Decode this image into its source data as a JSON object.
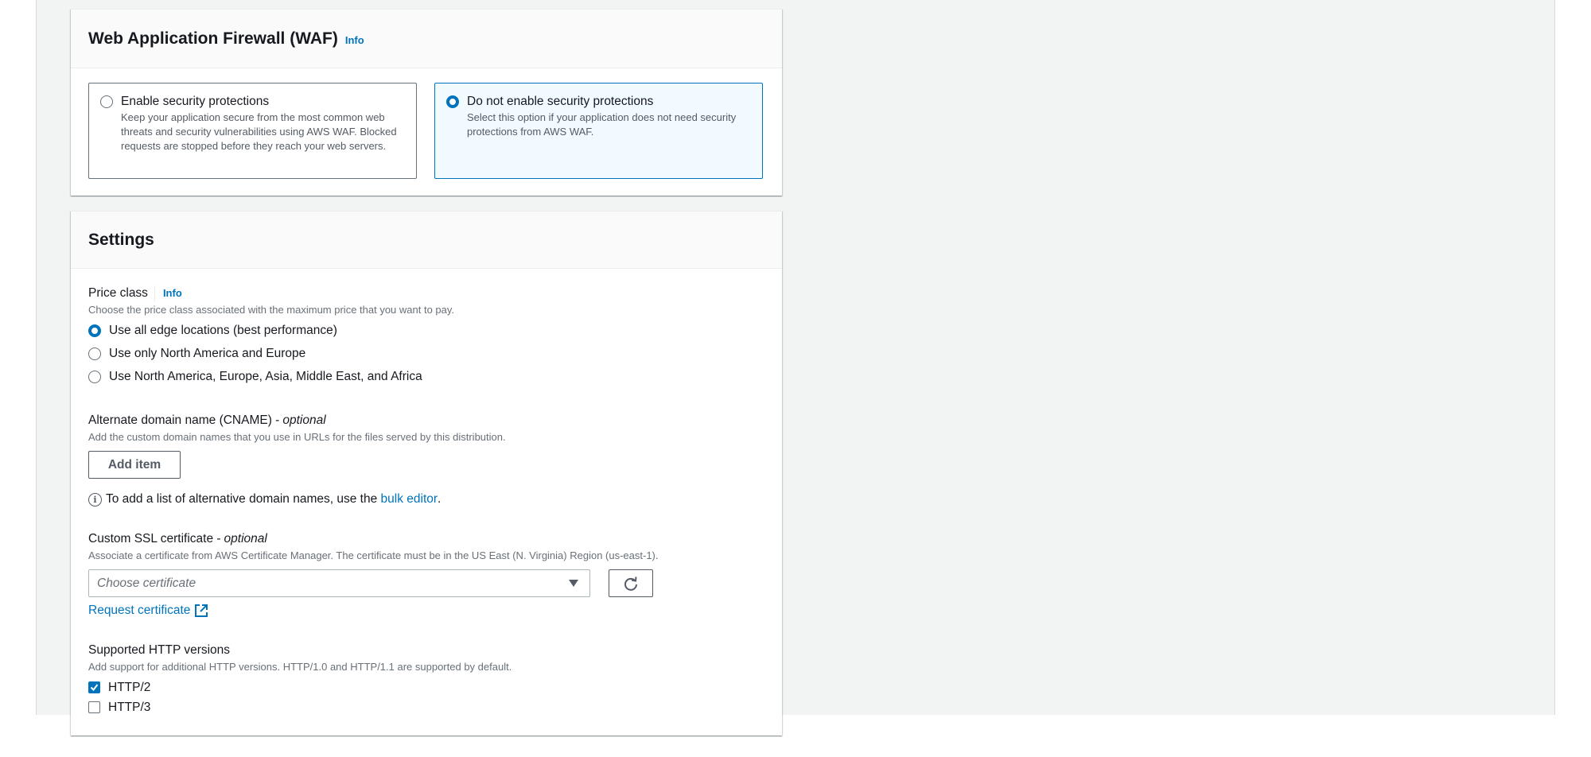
{
  "waf": {
    "title": "Web Application Firewall (WAF)",
    "info_label": "Info",
    "options": [
      {
        "title": "Enable security protections",
        "description": "Keep your application secure from the most common web threats and security vulnerabilities using AWS WAF. Blocked requests are stopped before they reach your web servers.",
        "selected": false
      },
      {
        "title": "Do not enable security protections",
        "description": "Select this option if your application does not need security protections from AWS WAF.",
        "selected": true
      }
    ]
  },
  "settings": {
    "title": "Settings",
    "price_class": {
      "label": "Price class",
      "info_label": "Info",
      "description": "Choose the price class associated with the maximum price that you want to pay.",
      "options": [
        {
          "label": "Use all edge locations (best performance)",
          "selected": true
        },
        {
          "label": "Use only North America and Europe",
          "selected": false
        },
        {
          "label": "Use North America, Europe, Asia, Middle East, and Africa",
          "selected": false
        }
      ]
    },
    "cname": {
      "label": "Alternate domain name (CNAME) -",
      "optional": "optional",
      "description": "Add the custom domain names that you use in URLs for the files served by this distribution.",
      "add_button": "Add item",
      "info_text": "To add a list of alternative domain names, use the",
      "info_link": "bulk editor",
      "info_suffix": "."
    },
    "ssl": {
      "label": "Custom SSL certificate -",
      "optional": "optional",
      "description": "Associate a certificate from AWS Certificate Manager. The certificate must be in the US East (N. Virginia) Region (us-east-1).",
      "select_placeholder": "Choose certificate",
      "request_link": "Request certificate"
    },
    "http_versions": {
      "label": "Supported HTTP versions",
      "description": "Add support for additional HTTP versions. HTTP/1.0 and HTTP/1.1 are supported by default.",
      "options": [
        {
          "label": "HTTP/2",
          "checked": true
        },
        {
          "label": "HTTP/3",
          "checked": false
        }
      ]
    }
  },
  "colors": {
    "accent": "#0073bb",
    "selected_tile_bg": "#f1faff",
    "page_bg": "#f2f3f3"
  }
}
